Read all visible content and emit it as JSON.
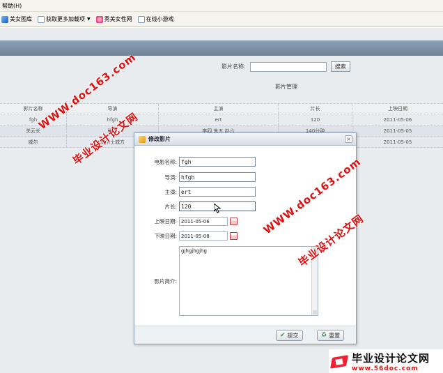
{
  "browser": {
    "menu_help": "帮助(H)",
    "favorites": [
      {
        "label": "美女图库",
        "icon": "ie-icon"
      },
      {
        "label": "获取更多加载项",
        "icon": "page-icon",
        "dropdown": true
      },
      {
        "label": "秀美女性网",
        "icon": "flower-icon"
      },
      {
        "label": "在线小游戏",
        "icon": "page-icon"
      }
    ]
  },
  "search": {
    "label": "影片名称:",
    "value": "",
    "button": "搜索"
  },
  "section_title": "影片管理",
  "table": {
    "headers": [
      "影片名称",
      "导演",
      "主演",
      "片长",
      "上映日期"
    ],
    "rows": [
      [
        "fgh",
        "hfgh",
        "ert",
        "120",
        "2011-05-06"
      ],
      [
        "关云长",
        "张三",
        "李四 朱五 赵六",
        "140分钟",
        "2011-05-05"
      ],
      [
        "威尔",
        "威尔士城方",
        "",
        "",
        "2011-05-05"
      ]
    ]
  },
  "dialog": {
    "title": "修改影片",
    "close_icon": "close-icon",
    "fields": {
      "name_label": "电影名称:",
      "name_value": "fgh",
      "director_label": "导演:",
      "director_value": "hfgh",
      "actor_label": "主演:",
      "actor_value": "ert",
      "length_label": "片长:",
      "length_value": "120",
      "release_label": "上映日期:",
      "release_value": "2011-05-06",
      "offline_label": "下映日期:",
      "offline_value": "2011-05-08",
      "intro_label": "影片简介:",
      "intro_value": "gjhgjhgjhg"
    },
    "submit_label": "提交",
    "reset_label": "重置"
  },
  "watermarks": {
    "site": "WWW.doc163.com",
    "name": "毕业设计论文网"
  },
  "brand": {
    "name": "毕业设计论文网",
    "url": "www.56doc.com"
  }
}
